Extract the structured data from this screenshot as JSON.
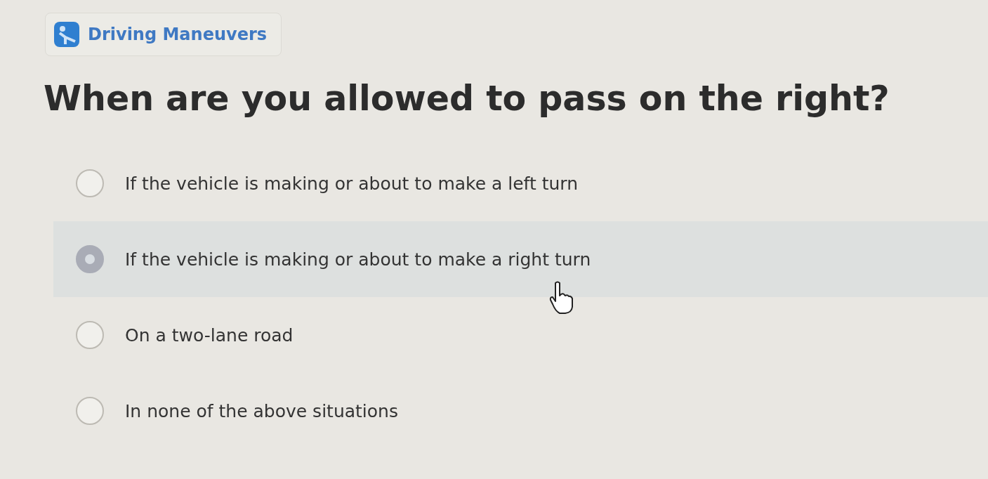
{
  "category": {
    "label": "Driving Maneuvers"
  },
  "question": "When are you allowed to pass on the right?",
  "options": [
    {
      "label": "If the vehicle is making or about to make a left turn",
      "selected": false
    },
    {
      "label": "If the vehicle is making or about to make a right turn",
      "selected": true
    },
    {
      "label": "On a two-lane road",
      "selected": false
    },
    {
      "label": "In none of the above situations",
      "selected": false
    }
  ]
}
